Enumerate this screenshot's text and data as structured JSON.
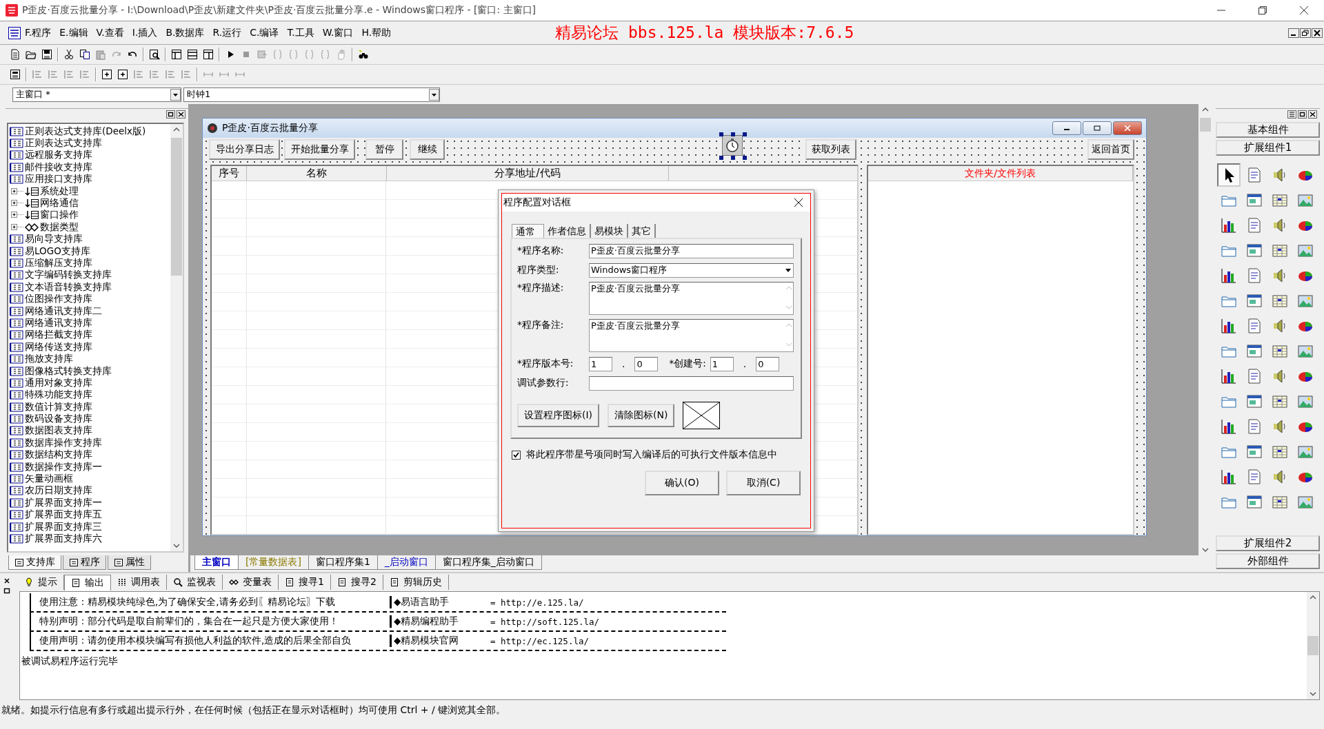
{
  "window": {
    "title": "P歪皮·百度云批量分享 - I:\\Download\\P歪皮\\新建文件夹\\P歪皮·百度云批量分享.e - Windows窗口程序 - [窗口: 主窗口]"
  },
  "menu": [
    "F.程序",
    "E.编辑",
    "V.查看",
    "I.插入",
    "B.数据库",
    "R.运行",
    "C.编译",
    "T.工具",
    "W.窗口",
    "H.帮助"
  ],
  "banner": "精易论坛 bbs.125.la 模块版本:7.6.5",
  "selectors": [
    {
      "value": "主窗口 *"
    },
    {
      "value": "时钟1"
    }
  ],
  "library_panel": {
    "items": [
      {
        "label": "正则表达式支持库(Deelx版)"
      },
      {
        "label": "正则表达式支持库"
      },
      {
        "label": "远程服务支持库"
      },
      {
        "label": "邮件接收支持库"
      },
      {
        "label": "应用接口支持库",
        "children": [
          {
            "label": "系统处理",
            "kind": "commands",
            "expanded": false
          },
          {
            "label": "网络通信",
            "kind": "commands",
            "expanded": false
          },
          {
            "label": "窗口操作",
            "kind": "commands",
            "expanded": false
          },
          {
            "label": "数据类型",
            "kind": "types",
            "expanded": false
          }
        ]
      },
      {
        "label": "易向导支持库"
      },
      {
        "label": "易LOGO支持库"
      },
      {
        "label": "压缩解压支持库"
      },
      {
        "label": "文字编码转换支持库"
      },
      {
        "label": "文本语音转换支持库"
      },
      {
        "label": "位图操作支持库"
      },
      {
        "label": "网络通讯支持库二"
      },
      {
        "label": "网络通讯支持库"
      },
      {
        "label": "网络拦截支持库"
      },
      {
        "label": "网络传送支持库"
      },
      {
        "label": "拖放支持库"
      },
      {
        "label": "图像格式转换支持库"
      },
      {
        "label": "通用对象支持库"
      },
      {
        "label": "特殊功能支持库"
      },
      {
        "label": "数值计算支持库"
      },
      {
        "label": "数码设备支持库"
      },
      {
        "label": "数据图表支持库"
      },
      {
        "label": "数据库操作支持库"
      },
      {
        "label": "数据结构支持库"
      },
      {
        "label": "数据操作支持库一"
      },
      {
        "label": "矢量动画框"
      },
      {
        "label": "农历日期支持库"
      },
      {
        "label": "扩展界面支持库一"
      },
      {
        "label": "扩展界面支持库五"
      },
      {
        "label": "扩展界面支持库三"
      },
      {
        "label": "扩展界面支持库六"
      }
    ],
    "tabs": [
      {
        "label": "支持库",
        "selected": true
      },
      {
        "label": "程序",
        "selected": false
      },
      {
        "label": "属性",
        "selected": false
      }
    ]
  },
  "design_form": {
    "title": "P歪皮·百度云批量分享",
    "buttons": [
      "导出分享日志",
      "开始批量分享",
      "暂停",
      "继续"
    ],
    "timer": {
      "selected": true
    },
    "right_buttons": [
      "获取列表",
      "返回首页"
    ],
    "columns": [
      "序号",
      "名称",
      "分享地址/代码"
    ],
    "file_list_header": "文件夹/文件列表"
  },
  "dialog": {
    "title": "程序配置对话框",
    "tabs": [
      {
        "label": "通常",
        "selected": true
      },
      {
        "label": "作者信息",
        "selected": false
      },
      {
        "label": "易模块",
        "selected": false
      },
      {
        "label": "其它",
        "selected": false
      }
    ],
    "name": {
      "label": "*程序名称:",
      "value": "P歪皮·百度云批量分享"
    },
    "type": {
      "label": "程序类型:",
      "value": "Windows窗口程序"
    },
    "description": {
      "label": "*程序描述:",
      "value": "P歪皮·百度云批量分享"
    },
    "note": {
      "label": "*程序备注:",
      "value": "P歪皮·百度云批量分享"
    },
    "version": {
      "label": "*程序版本号:",
      "major": "1",
      "separator": ".",
      "minor": "0"
    },
    "build": {
      "label": "*创建号:",
      "major": "1",
      "separator": ".",
      "minor": "0"
    },
    "debug_args": {
      "label": "调试参数行:"
    },
    "icon_buttons": [
      "设置程序图标(I)",
      "清除图标(N)"
    ],
    "write_version": {
      "label": "将此程序带星号项同时写入编译后的可执行文件版本信息中",
      "checked": true
    },
    "buttons": [
      "确认(O)",
      "取消(C)"
    ]
  },
  "editor_tabs": [
    {
      "label": "主窗口",
      "kind": "form",
      "selected": true
    },
    {
      "label": "[常量数据表]",
      "kind": "constants",
      "selected": false
    },
    {
      "label": "窗口程序集1",
      "kind": "code",
      "selected": false
    },
    {
      "label": "_启动窗口",
      "kind": "form",
      "selected": false
    },
    {
      "label": "窗口程序集_启动窗口",
      "kind": "code",
      "selected": false
    }
  ],
  "palette": {
    "groups": [
      {
        "label": "基本组件"
      },
      {
        "label": "扩展组件1"
      }
    ],
    "tools": [
      {
        "selected": true
      },
      {
        "selected": false
      },
      {
        "selected": false
      },
      {
        "selected": false
      },
      {
        "selected": false
      },
      {
        "selected": false
      },
      {
        "selected": false
      },
      {
        "selected": false
      },
      {
        "selected": false
      },
      {
        "selected": false
      },
      {
        "selected": false
      },
      {
        "selected": false
      },
      {
        "selected": false
      },
      {
        "selected": false
      },
      {
        "selected": false
      },
      {
        "selected": false
      },
      {
        "selected": false
      },
      {
        "selected": false
      },
      {
        "selected": false
      },
      {
        "selected": false
      },
      {
        "selected": false
      },
      {
        "selected": false
      },
      {
        "selected": false
      },
      {
        "selected": false
      },
      {
        "selected": false
      },
      {
        "selected": false
      },
      {
        "selected": false
      },
      {
        "selected": false
      },
      {
        "selected": false
      },
      {
        "selected": false
      },
      {
        "selected": false
      },
      {
        "selected": false
      },
      {
        "selected": false
      },
      {
        "selected": false
      },
      {
        "selected": false
      },
      {
        "selected": false
      },
      {
        "selected": false
      },
      {
        "selected": false
      },
      {
        "selected": false
      },
      {
        "selected": false
      },
      {
        "selected": false
      },
      {
        "selected": false
      },
      {
        "selected": false
      },
      {
        "selected": false
      },
      {
        "selected": false
      },
      {
        "selected": false
      },
      {
        "selected": false
      },
      {
        "selected": false
      },
      {
        "selected": false
      },
      {
        "selected": false
      },
      {
        "selected": false
      },
      {
        "selected": false
      },
      {
        "selected": false
      },
      {
        "selected": false
      },
      {
        "selected": false
      },
      {
        "selected": false
      }
    ],
    "bottom_groups": [
      {
        "label": "扩展组件2"
      },
      {
        "label": "外部组件"
      }
    ]
  },
  "output_panel": {
    "tabs": [
      {
        "label": "提示",
        "selected": false
      },
      {
        "label": "输出",
        "selected": true
      },
      {
        "label": "调用表",
        "selected": false
      },
      {
        "label": "监视表",
        "selected": false
      },
      {
        "label": "变量表",
        "selected": false
      },
      {
        "label": "搜寻1",
        "selected": false
      },
      {
        "label": "搜寻2",
        "selected": false
      },
      {
        "label": "剪辑历史",
        "selected": false
      }
    ],
    "notices": [
      {
        "text": "使用注意：精易模块纯绿色,为了确保安全,请务必到〖精易论坛〗下载",
        "helper": "◆易语言助手",
        "url": "=  http://e.125.la/"
      },
      {
        "text": "特别声明：部分代码是取自前辈们的，集合在一起只是方便大家使用！",
        "helper": "◆精易编程助手",
        "url": "=  http://soft.125.la/"
      },
      {
        "text": "使用声明：请勿使用本模块编写有损他人利益的软件,造成的后果全部自负",
        "helper": "◆精易模块官网",
        "url": "=  http://ec.125.la/"
      }
    ],
    "message": "被调试易程序运行完毕"
  },
  "status_bar": {
    "text": "就绪。如提示行信息有多行或超出提示行外，在任何时候（包括正在显示对话框时）均可使用 Ctrl + / 键浏览其全部。"
  }
}
